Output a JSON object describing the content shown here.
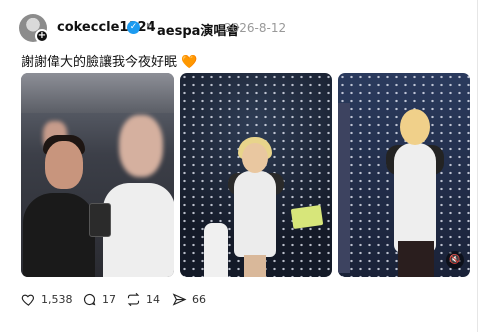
{
  "post": {
    "username": "cokeccle1124",
    "community": "aespa演唱會",
    "separator": "‣",
    "date": "2026-8-12",
    "caption": "謝謝偉大的臉讓我今夜好眠",
    "caption_emoji": "🧡",
    "avatar_plus": "+",
    "verified_icon": "✓"
  },
  "media": {
    "sound_icon": "🔇"
  },
  "actions": {
    "likes": "1,538",
    "comments": "17",
    "reposts": "14",
    "shares": "66"
  },
  "colors": {
    "verified": "#1d9bf0",
    "emoji_heart": "#f08a3c"
  }
}
